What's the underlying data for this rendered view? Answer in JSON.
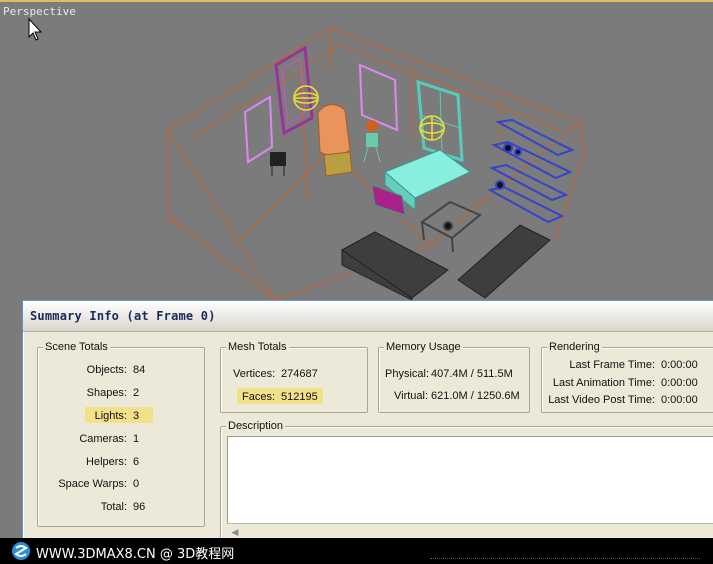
{
  "viewport": {
    "label": "Perspective"
  },
  "dialog": {
    "title": "Summary Info (at Frame 0)",
    "scene_totals": {
      "legend": "Scene Totals",
      "rows": [
        {
          "label": "Objects:",
          "value": "84"
        },
        {
          "label": "Shapes:",
          "value": "2"
        },
        {
          "label": "Lights:",
          "value": "3"
        },
        {
          "label": "Cameras:",
          "value": "1"
        },
        {
          "label": "Helpers:",
          "value": "6"
        },
        {
          "label": "Space Warps:",
          "value": "0"
        },
        {
          "label": "Total:",
          "value": "96"
        }
      ]
    },
    "mesh_totals": {
      "legend": "Mesh Totals",
      "vertices_label": "Vertices:",
      "vertices_value": "274687",
      "faces_label": "Faces:",
      "faces_value": "512195"
    },
    "memory_usage": {
      "legend": "Memory Usage",
      "physical_label": "Physical:",
      "physical_value": "407.4M / 511.5M",
      "virtual_label": "Virtual:",
      "virtual_value": "621.0M / 1250.6M"
    },
    "rendering": {
      "legend": "Rendering",
      "rows": [
        {
          "label": "Last Frame Time:",
          "value": "0:00:00"
        },
        {
          "label": "Last Animation Time:",
          "value": "0:00:00"
        },
        {
          "label": "Last Video Post Time:",
          "value": "0:00:00"
        }
      ]
    },
    "description": {
      "legend": "Description"
    }
  },
  "watermark": {
    "text": "WWW.3DMAX8.CN @ 3D教程网"
  },
  "colors": {
    "highlight": "#f2e08a",
    "wire_orange": "#d2691e",
    "wire_magenta": "#cc66cc",
    "wire_blue": "#3333cc",
    "wire_cyan": "#66ddcc",
    "dark_furniture": "#3a3a3a"
  }
}
